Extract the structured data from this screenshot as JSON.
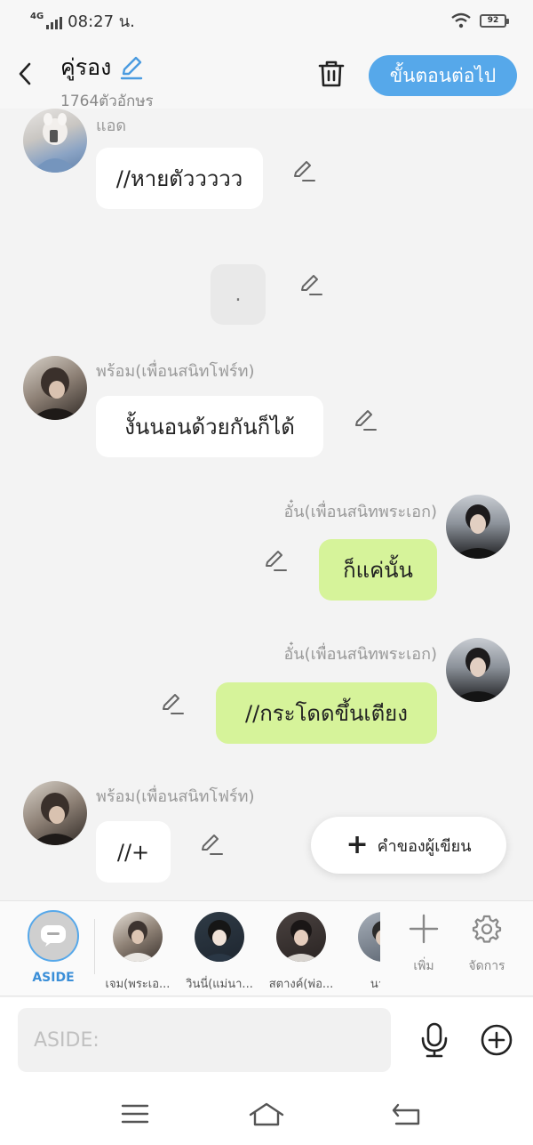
{
  "status": {
    "network": "4G",
    "time": "08:27 น.",
    "battery": "92"
  },
  "header": {
    "title": "คู่รอง",
    "subtitle": "1764ตัวอักษร",
    "next_label": "ขั้นตอนต่อไป"
  },
  "messages": [
    {
      "name": "แอด",
      "text": "//หายตัววววว"
    },
    {
      "text": "."
    },
    {
      "name": "พร้อม(เพื่อนสนิทโฟร์ท)",
      "text": "งั้นนอนด้วยกันก็ได้"
    },
    {
      "name": "อั๋น(เพื่อนสนิทพระเอก)",
      "text": "ก็แค่นั้น"
    },
    {
      "name": "อั๋น(เพื่อนสนิทพระเอก)",
      "text": "//กระโดดขึ้นเตียง"
    },
    {
      "name": "พร้อม(เพื่อนสนิทโฟร์ท)",
      "text": "//+"
    }
  ],
  "author_button": {
    "label": "คำของผู้เขียน"
  },
  "character_bar": {
    "aside_label": "ASIDE",
    "characters": [
      {
        "label": "เจม(พระเอ..."
      },
      {
        "label": "วินนี่(แม่นา..."
      },
      {
        "label": "สตางค์(พ่อ..."
      },
      {
        "label": "นายเ"
      }
    ],
    "add_label": "เพิ่ม",
    "manage_label": "จัดการ"
  },
  "input": {
    "placeholder": "ASIDE:"
  },
  "colors": {
    "accent": "#56a8ea",
    "green_bubble": "#d6f39a",
    "white_bubble": "#ffffff"
  }
}
